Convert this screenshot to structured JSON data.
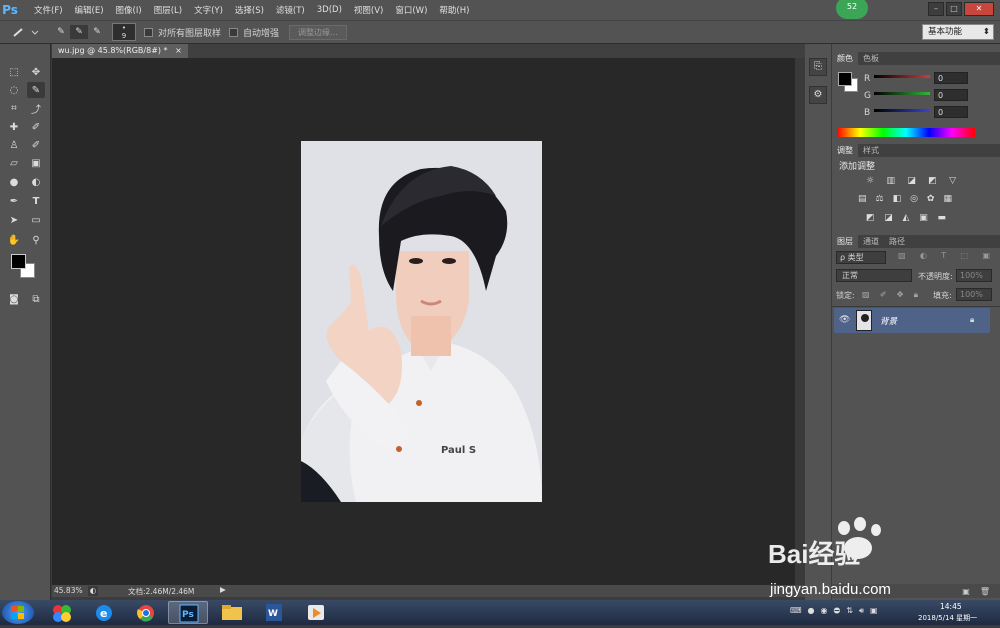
{
  "app": {
    "logo": "Ps",
    "menus": [
      "文件(F)",
      "编辑(E)",
      "图像(I)",
      "图层(L)",
      "文字(Y)",
      "选择(S)",
      "滤镜(T)",
      "3D(D)",
      "视图(V)",
      "窗口(W)",
      "帮助(H)"
    ],
    "badge": "52",
    "window_controls": [
      "–",
      "□",
      "✕"
    ]
  },
  "options": {
    "brush_size": "9",
    "sample_all_layers": "对所有图层取样",
    "auto_enhance": "自动增强",
    "refine_edge": "调整边缘...",
    "workspace": "基本功能"
  },
  "document": {
    "tab_label": "wu.jpg @ 45.8%(RGB/8#) *",
    "tab_close": "×",
    "zoom": "45.83%",
    "doc_info": "文档:2.46M/2.46M"
  },
  "color_panel": {
    "tabs": [
      "颜色",
      "色板"
    ],
    "channels": [
      {
        "label": "R",
        "value": "0",
        "color": "#d23b3b"
      },
      {
        "label": "G",
        "value": "0",
        "color": "#34b43c"
      },
      {
        "label": "B",
        "value": "0",
        "color": "#3744d6"
      }
    ]
  },
  "adjust_panel": {
    "tabs": [
      "调整",
      "样式"
    ],
    "title": "添加调整"
  },
  "layers_panel": {
    "tabs": [
      "图层",
      "通道",
      "路径"
    ],
    "filter_type": "ρ 类型",
    "blend_mode": "正常",
    "opacity_label": "不透明度:",
    "opacity_value": "100%",
    "lock_label": "锁定:",
    "fill_label": "填充:",
    "fill_value": "100%",
    "layers": [
      {
        "name": "背景"
      }
    ]
  },
  "taskbar": {
    "time": "14:45",
    "date": "2018/5/14 星期一"
  },
  "watermark": {
    "brand": "Bai经验",
    "url": "jingyan.baidu.com"
  }
}
